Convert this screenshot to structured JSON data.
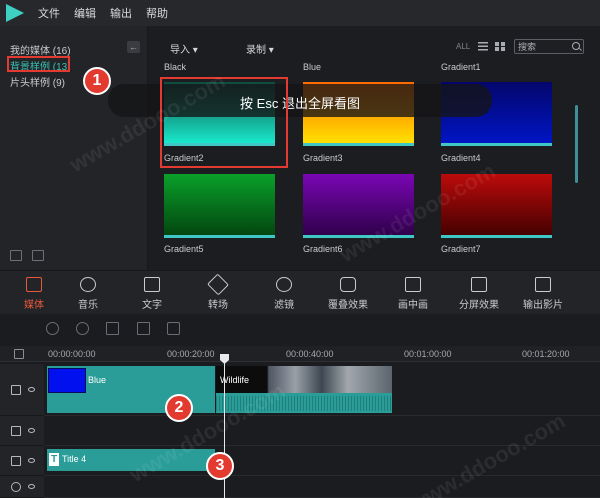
{
  "menu": {
    "items": [
      "文件",
      "编辑",
      "输出",
      "帮助"
    ]
  },
  "library": {
    "items": [
      {
        "label": "我的媒体 (16)"
      },
      {
        "label": "背景样例 (13)"
      },
      {
        "label": "片头样例 (9)"
      }
    ]
  },
  "media_toolbar": {
    "import_label": "导入 ▾",
    "record_label": "录制 ▾",
    "all_label": "ALL",
    "search_placeholder": "搜索"
  },
  "top_labels": [
    "Black",
    "Blue",
    "Gradient1"
  ],
  "tiles": [
    {
      "label": "Gradient2",
      "from": "#0f4a3e",
      "to": "#19f0d2"
    },
    {
      "label": "Gradient3",
      "from": "#ff6a00",
      "to": "#ffe600"
    },
    {
      "label": "Gradient4",
      "from": "#04066b",
      "to": "#0016c9"
    },
    {
      "label": "Gradient5",
      "from": "#0aa02a",
      "to": "#03420f"
    },
    {
      "label": "Gradient6",
      "from": "#7a06b4",
      "to": "#2c0046"
    },
    {
      "label": "Gradient7",
      "from": "#bc0b0b",
      "to": "#3f0000"
    }
  ],
  "toast": {
    "text": "按 Esc 退出全屏看图"
  },
  "tools": [
    {
      "label": "媒体",
      "active": true
    },
    {
      "label": "音乐"
    },
    {
      "label": "文字"
    },
    {
      "label": "转场"
    },
    {
      "label": "滤镜"
    },
    {
      "label": "覆叠效果"
    },
    {
      "label": "画中画"
    },
    {
      "label": "分屏效果"
    },
    {
      "label": "输出影片"
    }
  ],
  "ruler": {
    "times": [
      "00:00:00:00",
      "00:00:20:00",
      "00:00:40:00",
      "00:01:00:00",
      "00:01:20:00"
    ]
  },
  "clips": {
    "blue_label": "Blue",
    "wildlife_label": "Wildlife",
    "title_label": "Title 4"
  },
  "annotations": [
    "1",
    "2",
    "3"
  ],
  "watermark": "www.ddooo.com"
}
